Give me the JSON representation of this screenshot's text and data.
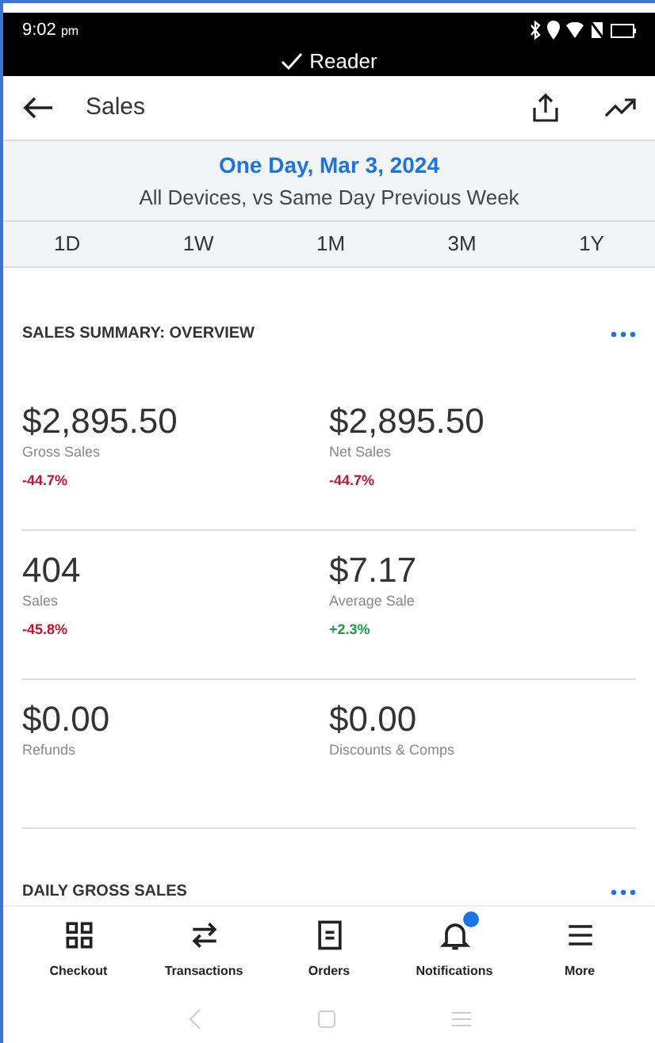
{
  "status_bar": {
    "time": "9:02",
    "time_suffix": "pm",
    "reader": "Reader"
  },
  "header": {
    "title": "Sales"
  },
  "period": {
    "title": "One Day, Mar 3, 2024",
    "subtitle": "All Devices, vs Same Day Previous Week"
  },
  "ranges": [
    "1D",
    "1W",
    "1M",
    "3M",
    "1Y"
  ],
  "summary": {
    "title": "SALES SUMMARY: OVERVIEW",
    "rows": [
      [
        {
          "value": "$2,895.50",
          "label": "Gross Sales",
          "change": "-44.7%",
          "kind": "down"
        },
        {
          "value": "$2,895.50",
          "label": "Net Sales",
          "change": "-44.7%",
          "kind": "down"
        }
      ],
      [
        {
          "value": "404",
          "label": "Sales",
          "change": "-45.8%",
          "kind": "down"
        },
        {
          "value": "$7.17",
          "label": "Average Sale",
          "change": "+2.3%",
          "kind": "up"
        }
      ],
      [
        {
          "value": "$0.00",
          "label": "Refunds"
        },
        {
          "value": "$0.00",
          "label": "Discounts & Comps"
        }
      ]
    ]
  },
  "daily": {
    "title": "DAILY GROSS SALES"
  },
  "nav": [
    {
      "label": "Checkout",
      "badge": false
    },
    {
      "label": "Transactions",
      "badge": false
    },
    {
      "label": "Orders",
      "badge": false
    },
    {
      "label": "Notifications",
      "badge": true
    },
    {
      "label": "More",
      "badge": false
    }
  ]
}
